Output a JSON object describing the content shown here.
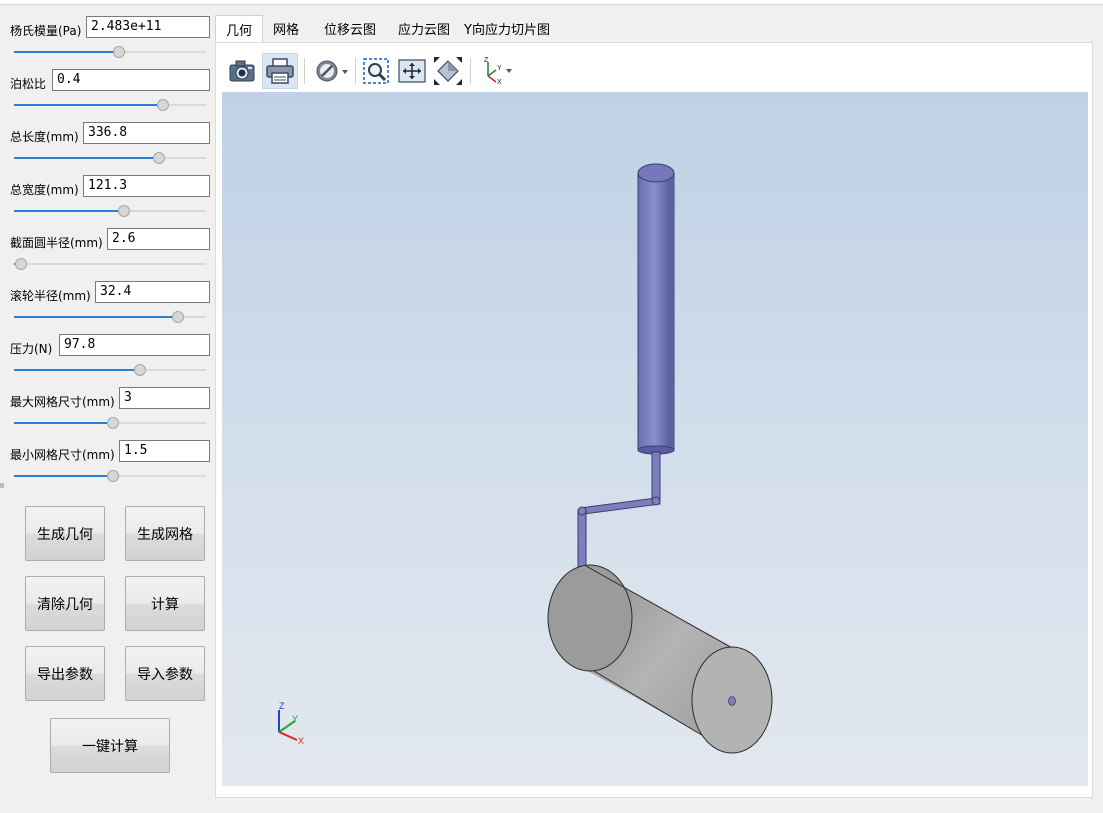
{
  "params": [
    {
      "label": "杨氏模量(Pa)",
      "value": "2.483e+11",
      "slider": 0.54
    },
    {
      "label": "泊松比",
      "value": "0.4",
      "slider": 0.77
    },
    {
      "label": "总长度(mm)",
      "value": "336.8",
      "slider": 0.75
    },
    {
      "label": "总宽度(mm)",
      "value": "121.3",
      "slider": 0.57
    },
    {
      "label": "截面圆半径(mm)",
      "value": "2.6",
      "slider": 0.03
    },
    {
      "label": "滚轮半径(mm)",
      "value": "32.4",
      "slider": 0.85
    },
    {
      "label": "压力(N)",
      "value": "97.8",
      "slider": 0.65
    },
    {
      "label": "最大网格尺寸(mm)",
      "value": "3",
      "slider": 0.51
    },
    {
      "label": "最小网格尺寸(mm)",
      "value": "1.5",
      "slider": 0.51
    }
  ],
  "buttons": {
    "gen_geometry": "生成几何",
    "gen_mesh": "生成网格",
    "clear_geometry": "清除几何",
    "compute": "计算",
    "export_params": "导出参数",
    "import_params": "导入参数",
    "one_click": "一键计算"
  },
  "tabs": [
    {
      "label": "几何",
      "active": true
    },
    {
      "label": "网格",
      "active": false
    },
    {
      "label": "位移云图",
      "active": false
    },
    {
      "label": "应力云图",
      "active": false
    },
    {
      "label": "Y向应力切片图",
      "active": false
    }
  ],
  "toolbar": [
    {
      "icon": "camera-icon",
      "pressed": false
    },
    {
      "icon": "printer-icon",
      "pressed": true
    },
    {
      "icon": "hide-objects-icon",
      "pressed": false
    },
    {
      "icon": "zoom-box-icon",
      "pressed": false
    },
    {
      "icon": "pan-icon",
      "pressed": false
    },
    {
      "icon": "fit-all-icon",
      "pressed": false
    },
    {
      "icon": "axis-view-icon",
      "pressed": false
    }
  ],
  "triad": {
    "x": "X",
    "y": "Y",
    "z": "Z"
  },
  "colors": {
    "accent": "#2a7fd4",
    "rod": "#7b7fbd",
    "roller": "#a9a9a9",
    "viewport_top": "#bed1e6",
    "viewport_bottom": "#e3e8ef"
  }
}
